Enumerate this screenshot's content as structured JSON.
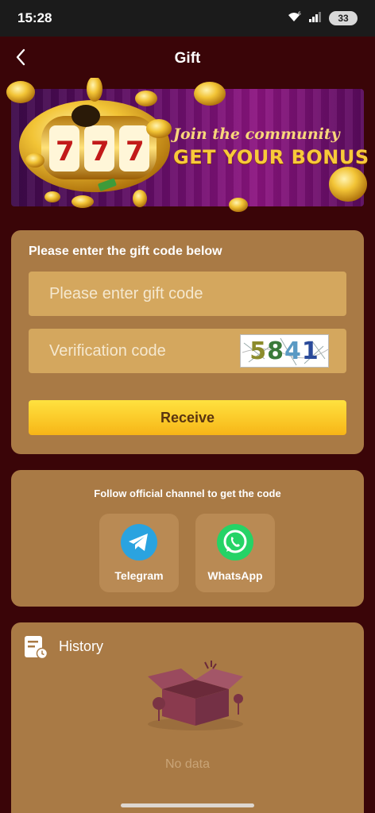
{
  "status_bar": {
    "time": "15:28",
    "battery": "33",
    "icons": [
      "wifi-icon",
      "signal-icon",
      "battery-icon"
    ]
  },
  "header": {
    "title": "Gift",
    "back_icon": "chevron-left-icon"
  },
  "banner": {
    "line1": "Join the community",
    "line2": "GET YOUR BONUS",
    "art": "slot-machine-coins"
  },
  "gift_form": {
    "label": "Please enter the gift code below",
    "gift_code_placeholder": "Please enter gift code",
    "gift_code_value": "",
    "verification_placeholder": "Verification code",
    "verification_value": "",
    "captcha_text": "5841",
    "receive_label": "Receive"
  },
  "follow": {
    "label": "Follow official channel to get the code",
    "channels": [
      {
        "label": "Telegram",
        "icon": "telegram-icon"
      },
      {
        "label": "WhatsApp",
        "icon": "whatsapp-icon"
      }
    ]
  },
  "history": {
    "title": "History",
    "icon": "history-document-icon",
    "empty_text": "No data"
  },
  "colors": {
    "page_bg": "#3a0508",
    "card_bg": "#a97a45",
    "field_bg": "#d4a75e",
    "button_gradient_top": "#ffe23f",
    "button_gradient_bottom": "#f7b517",
    "telegram": "#2aa3e0",
    "whatsapp": "#25d366"
  }
}
